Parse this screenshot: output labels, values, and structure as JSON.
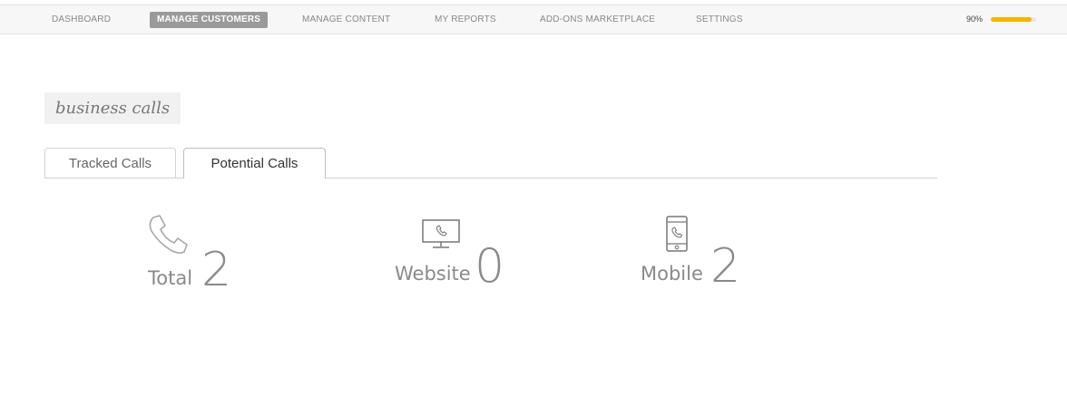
{
  "nav": {
    "items": [
      {
        "label": "DASHBOARD",
        "active": false
      },
      {
        "label": "MANAGE CUSTOMERS",
        "active": true
      },
      {
        "label": "MANAGE CONTENT",
        "active": false
      },
      {
        "label": "MY REPORTS",
        "active": false
      },
      {
        "label": "ADD-ONS MARKETPLACE",
        "active": false
      },
      {
        "label": "SETTINGS",
        "active": false
      }
    ],
    "progress": {
      "label": "90%",
      "value": 90,
      "color": "#f5b400"
    }
  },
  "section": {
    "title": "business calls"
  },
  "tabs": [
    {
      "label": "Tracked Calls",
      "active": false
    },
    {
      "label": "Potential Calls",
      "active": true
    }
  ],
  "stats": [
    {
      "label": "Total",
      "value": "2",
      "icon": "phone-icon"
    },
    {
      "label": "Website",
      "value": "0",
      "icon": "monitor-phone-icon"
    },
    {
      "label": "Mobile",
      "value": "2",
      "icon": "mobile-phone-icon"
    }
  ]
}
